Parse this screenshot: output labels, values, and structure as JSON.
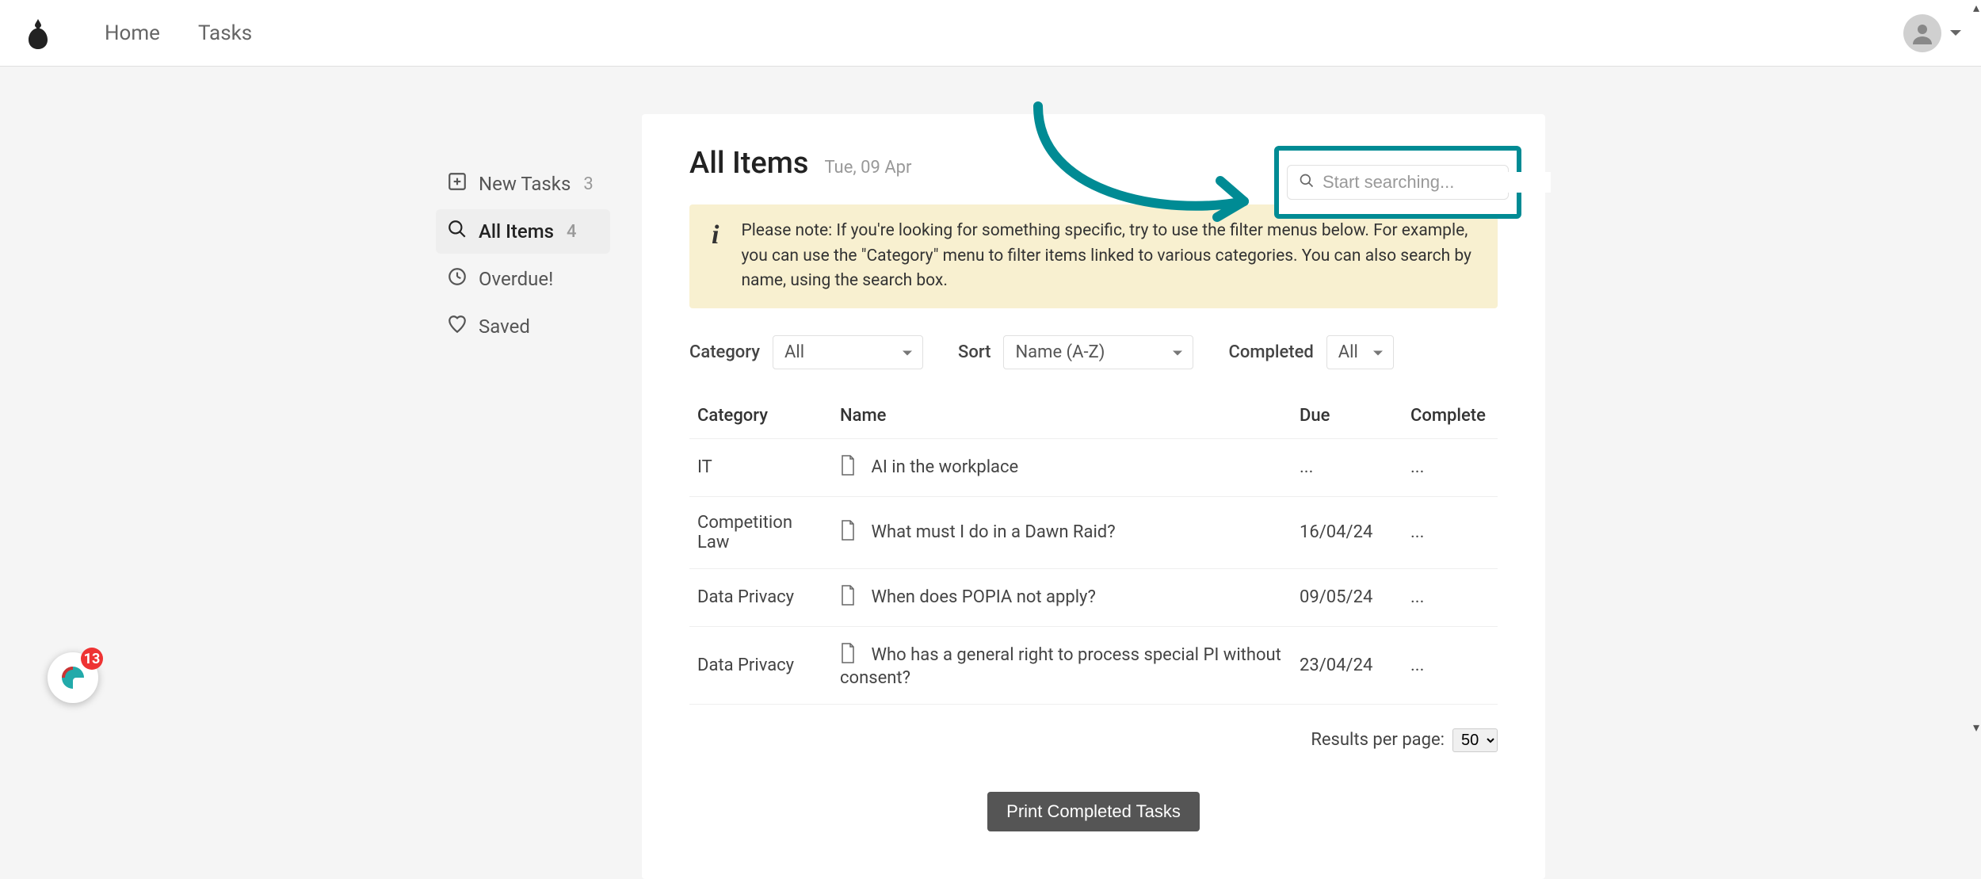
{
  "nav": {
    "links": [
      "Home",
      "Tasks"
    ]
  },
  "sidebar": {
    "items": [
      {
        "label": "New Tasks",
        "count": "3"
      },
      {
        "label": "All Items",
        "count": "4"
      },
      {
        "label": "Overdue!",
        "count": ""
      },
      {
        "label": "Saved",
        "count": ""
      }
    ]
  },
  "panel": {
    "title": "All Items",
    "date": "Tue, 09 Apr"
  },
  "search": {
    "placeholder": "Start searching..."
  },
  "info": {
    "text": "Please note: If you're looking for something specific, try to use the filter menus below. For example, you can use the \"Category\" menu to filter items linked to various categories. You can also search by name, using the search box."
  },
  "filters": {
    "category_label": "Category",
    "category_value": "All",
    "sort_label": "Sort",
    "sort_value": "Name (A-Z)",
    "completed_label": "Completed",
    "completed_value": "All"
  },
  "table": {
    "headers": {
      "category": "Category",
      "name": "Name",
      "due": "Due",
      "complete": "Complete"
    },
    "rows": [
      {
        "category": "IT",
        "name": "AI in the workplace",
        "due": "...",
        "complete": "..."
      },
      {
        "category": "Competition Law",
        "name": "What must I do in a Dawn Raid?",
        "due": "16/04/24",
        "complete": "..."
      },
      {
        "category": "Data Privacy",
        "name": "When does POPIA not apply?",
        "due": "09/05/24",
        "complete": "..."
      },
      {
        "category": "Data Privacy",
        "name": "Who has a general right to process special PI without consent?",
        "due": "23/04/24",
        "complete": "..."
      }
    ]
  },
  "pager": {
    "label": "Results per page:",
    "value": "50"
  },
  "print_button": "Print Completed Tasks",
  "chat": {
    "badge": "13"
  },
  "colors": {
    "highlight_border": "#008b94",
    "info_bg": "#f8f0d0",
    "btn_grey": "#555555"
  }
}
